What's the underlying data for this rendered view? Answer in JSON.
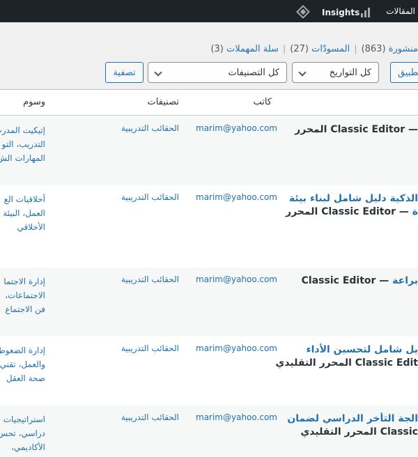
{
  "adminbar": {
    "posts_label": "المقالات",
    "insights_label": "Insights"
  },
  "views": {
    "published": "منشورة",
    "published_count": "(863)",
    "drafts": "المسودّات",
    "drafts_count": "(27)",
    "trash": "سلة المهملات",
    "trash_count": "(3)",
    "separator": "|"
  },
  "toolbar": {
    "apply_label": "تطبيق",
    "dates_select": "كل التواريخ",
    "categories_select": "كل التصنيفات",
    "filter_label": "تصفية"
  },
  "table": {
    "columns": {
      "author": "كاتب",
      "categories": "تصنيفات",
      "tags": "وسوم"
    },
    "rows": [
      {
        "title_lines": [
          {
            "link": "",
            "state": "— Classic Editor المحرر"
          }
        ],
        "author": "marim@yahoo.com",
        "categories": "الحقائب التدريبية",
        "tags": [
          "إتيكيت المدرب،",
          "التدريب، التو",
          "المهارات الش"
        ]
      },
      {
        "title_lines": [
          {
            "link": "الذكية دليل شامل لبناء بيئة",
            "state": ""
          },
          {
            "link": "ة",
            "state": " — Classic Editor المحرر"
          }
        ],
        "author": "marim@yahoo.com",
        "categories": "الحقائب التدريبية",
        "tags": [
          "أخلاقيات الع",
          "العمل، البيئة",
          "الأخلاقي"
        ]
      },
      {
        "title_lines": [
          {
            "link": "براعة",
            "state": " — Classic Editor"
          }
        ],
        "author": "marim@yahoo.com",
        "categories": "الحقائب التدريبية",
        "tags": [
          "إدارة الاجتما",
          "الاجتماعات،",
          "فن الاجتماع"
        ]
      },
      {
        "title_lines": [
          {
            "link": "يل شامل لتحسين الأداء",
            "state": ""
          },
          {
            "link": "",
            "state": "Classic Edit المحرر التقليدي"
          }
        ],
        "author": "marim@yahoo.com",
        "categories": "الحقائب التدريبية",
        "tags": [
          "إدارة الضغوط",
          "والعمل، تقني",
          "صحة العقل"
        ]
      },
      {
        "title_lines": [
          {
            "link": "الجة التأخر الدراسي لضمان",
            "state": ""
          },
          {
            "link": "",
            "state": "Classic المحرر التقليدي"
          }
        ],
        "author": "marim@yahoo.com",
        "categories": "الحقائب التدريبية",
        "tags": [
          "استراتيجيات",
          "دراسي، تحس",
          "الأكاديمي،"
        ]
      }
    ]
  }
}
